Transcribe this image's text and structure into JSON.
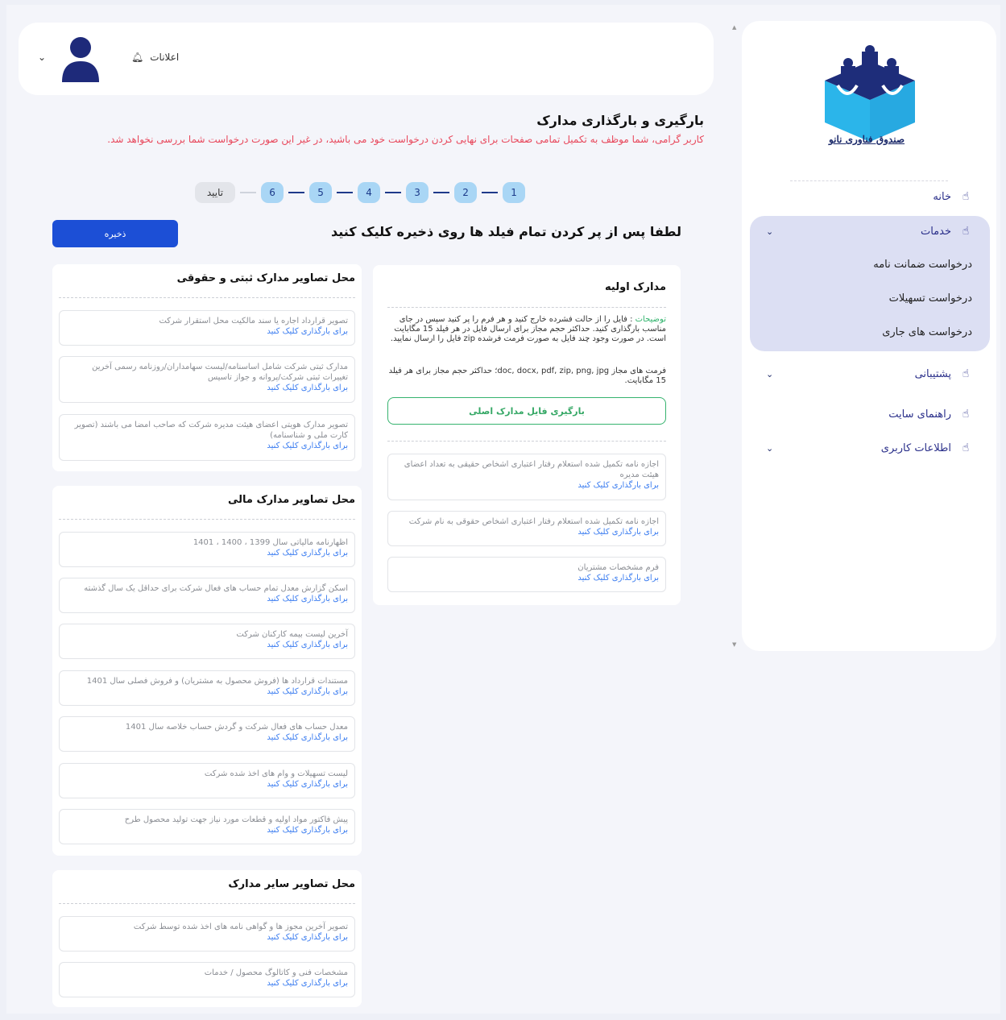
{
  "sidebar": {
    "logo_text": "صندوق فناوری نانو",
    "items": [
      {
        "label": "خانه"
      },
      {
        "label": "خدمات"
      },
      {
        "label": "پشتیبانی"
      },
      {
        "label": "راهنمای سایت"
      },
      {
        "label": "اطلاعات کاربری"
      }
    ],
    "sub_items": [
      {
        "label": "درخواست ضمانت نامه"
      },
      {
        "label": "درخواست تسهیلات"
      },
      {
        "label": "درخواست های جاری"
      }
    ]
  },
  "header": {
    "notifications_label": "اعلانات"
  },
  "page": {
    "title": "بارگیری و بارگذاری مدارک",
    "warning": "کاربر گرامی، شما موظف به تکمیل تمامی صفحات برای نهایی کردن درخواست خود می باشید، در غیر این صورت درخواست شما بررسی نخواهد شد.",
    "instruction": "لطفا پس از پر کردن تمام فیلد ها روی ذخیره کلیک کنید",
    "save_label": "ذخیره"
  },
  "steps": [
    "1",
    "2",
    "3",
    "4",
    "5",
    "6"
  ],
  "steps_final": "تایید",
  "upload_link": "برای بارگذاری کلیک کنید",
  "primary": {
    "title": "مدارک اولیه",
    "desc_label": "توضیحات",
    "desc_text": " : فایل را از حالت فشرده خارج کنید و هر فرم را پر کنید سپس در جای مناسب بارگذاری کنید. حداکثر حجم مجاز برای ارسال فایل در هر فیلد 15 مگابایت است. در صورت وجود چند فایل به صورت فرمت فرشده zip فایل را ارسال نمایید.",
    "formats_text": "فرمت های مجاز doc, docx, pdf, zip, png, jpg؛ حداکثر حجم مجاز برای هر فیلد 15 مگابایت.",
    "upload_main_label": "بارگیری فایل مدارک اصلی",
    "fields": [
      {
        "label": "اجازه نامه تکمیل شده استعلام رفتار اعتباری اشخاص حقیقی به تعداد اعضای هیئت مدیره"
      },
      {
        "label": "اجازه نامه تکمیل شده استعلام رفتار اعتباری اشخاص حقوقی به نام شرکت"
      },
      {
        "label": "فرم مشخصات مشتریان"
      }
    ]
  },
  "registration": {
    "title": "محل تصاویر مدارک ثبتی و حقوقی",
    "fields": [
      {
        "label": "تصویر قرارداد اجاره یا سند مالکیت محل استقرار شرکت"
      },
      {
        "label": "مدارک ثبتی شرکت شامل اساسنامه/لیست سهامداران/روزنامه رسمی آخرین تغییرات ثبتی شرکت/پروانه و جواز تاسیس"
      },
      {
        "label": "تصویر مدارک هویتی اعضای هیئت مدیره شرکت که صاحب امضا می باشند (تصویر کارت ملی و شناسنامه)"
      }
    ]
  },
  "financial": {
    "title": "محل تصاویر مدارک مالی",
    "fields": [
      {
        "label": "اظهارنامه مالیاتی سال 1399 ، 1400 ، 1401"
      },
      {
        "label": "اسکن گزارش معدل تمام حساب های فعال شرکت برای حداقل یک سال گذشته"
      },
      {
        "label": "آخرین لیست بیمه کارکنان شرکت"
      },
      {
        "label": "مستندات قرارداد ها (فروش محصول به مشتریان) و فروش فصلی سال 1401"
      },
      {
        "label": "معدل حساب های فعال شرکت و گردش حساب خلاصه سال 1401"
      },
      {
        "label": "لیست تسهیلات و وام های اخذ شده شرکت"
      },
      {
        "label": "پیش فاکتور مواد اولیه و قطعات مورد نیاز جهت تولید محصول طرح"
      }
    ]
  },
  "other": {
    "title": "محل تصاویر سایر مدارک",
    "fields": [
      {
        "label": "تصویر آخرین مجوز ها و گواهی نامه های اخذ شده توسط شرکت"
      },
      {
        "label": "مشخصات فنی و کاتالوگ محصول / خدمات"
      }
    ]
  },
  "icons": {
    "nav": "hand-icon",
    "bell": "bell-icon",
    "chevron": "chevron-down-icon",
    "avatar": "user-avatar-icon"
  },
  "colors": {
    "accent": "#1c4fd6",
    "warning": "#e8485c",
    "nav": "#2a2f8a",
    "link": "#3d7ef0",
    "success": "#36b36f",
    "step": "#a9d6f5"
  }
}
